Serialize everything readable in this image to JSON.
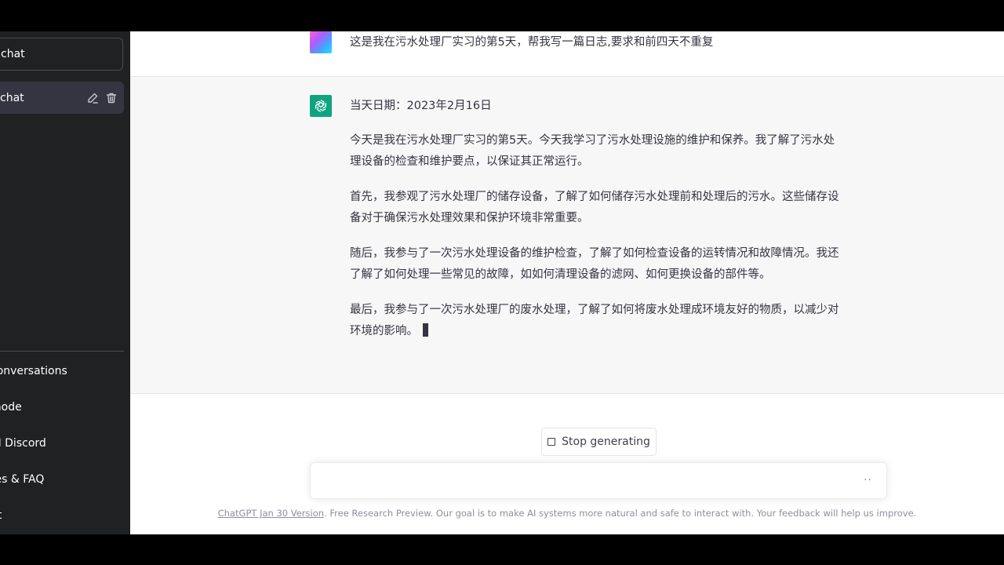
{
  "sidebar": {
    "new_chat": "chat",
    "chat_item": "chat",
    "menu": [
      {
        "label": "conversations",
        "icon": "trash-icon"
      },
      {
        "label": "mode",
        "icon": "moon-icon"
      },
      {
        "label": "AI Discord",
        "icon": "discord-icon"
      },
      {
        "label": "tes & FAQ",
        "icon": "external-link-icon"
      },
      {
        "label": "ut",
        "icon": "logout-icon"
      }
    ]
  },
  "conversation": {
    "user_message": "这是我在污水处理厂实习的第5天，帮我写一篇日志,要求和前四天不重复",
    "assistant_paragraphs": [
      "当天日期：2023年2月16日",
      "今天是我在污水处理厂实习的第5天。今天我学习了污水处理设施的维护和保养。我了解了污水处理设备的检查和维护要点，以保证其正常运行。",
      "首先，我参观了污水处理厂的储存设备，了解了如何储存污水处理前和处理后的污水。这些储存设备对于确保污水处理效果和保护环境非常重要。",
      "随后，我参与了一次污水处理设备的维护检查，了解了如何检查设备的运转情况和故障情况。我还了解了如何处理一些常见的故障，如如何清理设备的滤网、如何更换设备的部件等。",
      "最后，我参与了一次污水处理厂的废水处理，了解了如何将废水处理成环境友好的物质，以减少对环境的影响。"
    ]
  },
  "controls": {
    "stop_generating": "Stop generating",
    "input_placeholder": "",
    "input_dots": "··"
  },
  "footer": {
    "version_link": "ChatGPT Jan 30 Version",
    "text": ". Free Research Preview. Our goal is to make AI systems more natural and safe to interact with. Your feedback will help us improve."
  },
  "colors": {
    "sidebar_bg": "#202123",
    "active_item_bg": "#343541",
    "assistant_row_bg": "#f7f7f8",
    "bot_avatar": "#10a37f"
  }
}
